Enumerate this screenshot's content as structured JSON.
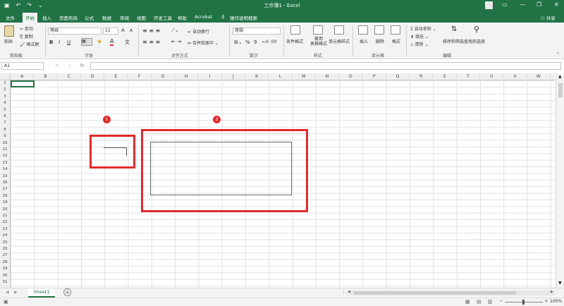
{
  "title": "工作簿1 - Excel",
  "tabs": [
    "文件",
    "开始",
    "插入",
    "页面布局",
    "公式",
    "数据",
    "审阅",
    "视图",
    "开发工具",
    "帮助",
    "Acrobat"
  ],
  "tell_me": "操作说明搜索",
  "share": "共享",
  "clipboard": {
    "paste": "粘贴",
    "cut": "剪切",
    "copy": "复制",
    "format_painter": "格式刷",
    "group": "剪贴板"
  },
  "font": {
    "name": "等线",
    "size": "11",
    "grow": "A",
    "shrink": "A",
    "bold": "B",
    "italic": "I",
    "underline": "U",
    "color_letter": "A",
    "group": "字体"
  },
  "alignment": {
    "wrap": "自动换行",
    "merge": "合并后居中",
    "group": "对齐方式"
  },
  "number": {
    "format": "常规",
    "percent": "%",
    "comma": "9",
    "group": "数字"
  },
  "styles": {
    "conditional": "条件格式",
    "table": "套用\n表格格式",
    "cell": "单元格样式",
    "group": "样式"
  },
  "cells": {
    "insert": "插入",
    "delete": "删除",
    "format": "格式",
    "group": "单元格"
  },
  "editing": {
    "autosum": "自动求和",
    "fill": "填充",
    "clear": "清除",
    "sort": "排序和筛选",
    "find": "查找和选择",
    "group": "编辑"
  },
  "formula": {
    "namebox": "A1",
    "cancel": "✕",
    "enter": "✓",
    "fx": "fx"
  },
  "columns": [
    "A",
    "B",
    "C",
    "D",
    "E",
    "F",
    "G",
    "H",
    "I",
    "J",
    "K",
    "L",
    "M",
    "N",
    "O",
    "P",
    "Q",
    "R",
    "S",
    "T",
    "U",
    "V",
    "W"
  ],
  "rows": [
    "1",
    "2",
    "3",
    "4",
    "5",
    "6",
    "7",
    "8",
    "9",
    "10",
    "11",
    "12",
    "13",
    "14",
    "15",
    "16",
    "17",
    "18",
    "19",
    "20",
    "21",
    "22",
    "23",
    "24",
    "25",
    "26",
    "27",
    "28",
    "29",
    "30",
    "31"
  ],
  "sheet": {
    "name": "Sheet1",
    "add": "+"
  },
  "zoom": "100%",
  "annotations": [
    "1",
    "2"
  ],
  "colors": {
    "excel_green": "#217346",
    "annotation_red": "#e02b2b"
  }
}
